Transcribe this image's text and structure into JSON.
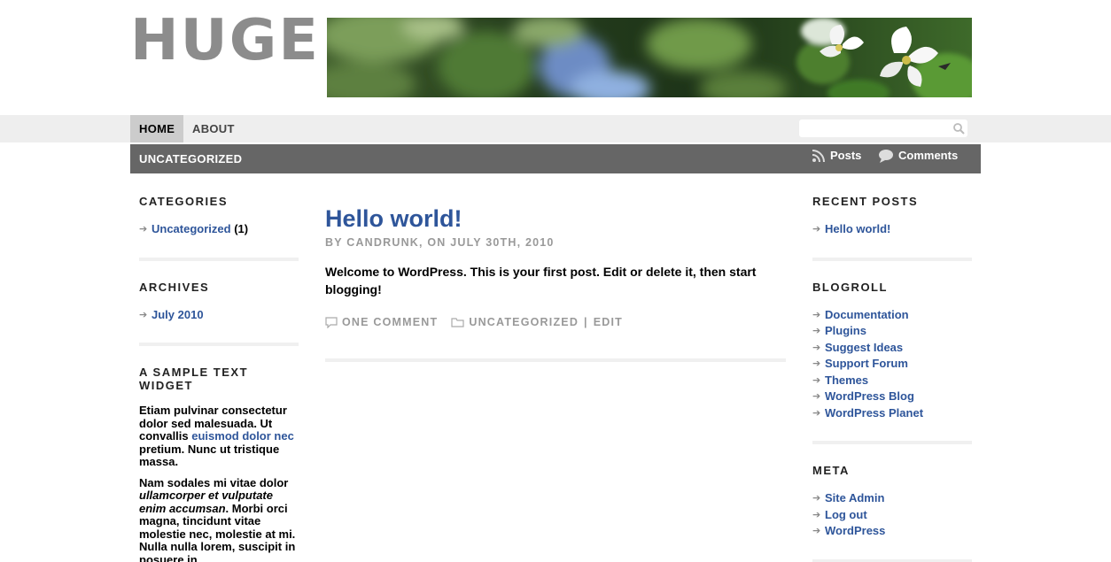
{
  "site": {
    "logo": "HUGE"
  },
  "nav": {
    "items": [
      {
        "label": "HOME",
        "active": true
      },
      {
        "label": "ABOUT",
        "active": false
      }
    ],
    "search_placeholder": ""
  },
  "subbar": {
    "category": "UNCATEGORIZED",
    "posts_feed": "Posts",
    "comments_feed": "Comments"
  },
  "left_sidebar": {
    "categories": {
      "title": "CATEGORIES",
      "items": [
        {
          "label": "Uncategorized",
          "count": "(1)"
        }
      ]
    },
    "archives": {
      "title": "ARCHIVES",
      "items": [
        {
          "label": "July 2010"
        }
      ]
    },
    "text_widget": {
      "title": "A SAMPLE TEXT WIDGET",
      "p1_a": "Etiam pulvinar consectetur dolor sed malesuada. Ut convallis ",
      "p1_link": "euismod dolor nec",
      "p1_b": " pretium. Nunc ut tristique massa.",
      "p2_a": "Nam sodales mi vitae dolor ",
      "p2_em": "ullamcorper et vulputate enim accumsan",
      "p2_b": ". Morbi orci magna, tincidunt vitae molestie nec, molestie at mi. Nulla nulla lorem, suscipit in posuere in,"
    }
  },
  "post": {
    "title": "Hello world!",
    "meta": "BY CANDRUNK, ON JULY 30TH, 2010",
    "body": "Welcome to WordPress. This is your first post. Edit or delete it, then start blogging!",
    "comments": "ONE COMMENT",
    "category": "UNCATEGORIZED",
    "separator": "|",
    "edit": "EDIT"
  },
  "right_sidebar": {
    "recent_posts": {
      "title": "RECENT POSTS",
      "items": [
        {
          "label": "Hello world!"
        }
      ]
    },
    "blogroll": {
      "title": "BLOGROLL",
      "items": [
        {
          "label": "Documentation"
        },
        {
          "label": "Plugins"
        },
        {
          "label": "Suggest Ideas"
        },
        {
          "label": "Support Forum"
        },
        {
          "label": "Themes"
        },
        {
          "label": "WordPress Blog"
        },
        {
          "label": "WordPress Planet"
        }
      ]
    },
    "meta": {
      "title": "META",
      "items": [
        {
          "label": "Site Admin"
        },
        {
          "label": "Log out"
        },
        {
          "label": "WordPress"
        }
      ]
    }
  },
  "icons": {
    "arrow": "➔",
    "search": "search-icon",
    "rss": "rss-icon",
    "comment": "comment-bubble-icon",
    "folder": "folder-icon"
  },
  "colors": {
    "link": "#2e559a",
    "navbar": "#eeeeee",
    "subbar": "#666666",
    "logo": "#8c8c8c"
  }
}
